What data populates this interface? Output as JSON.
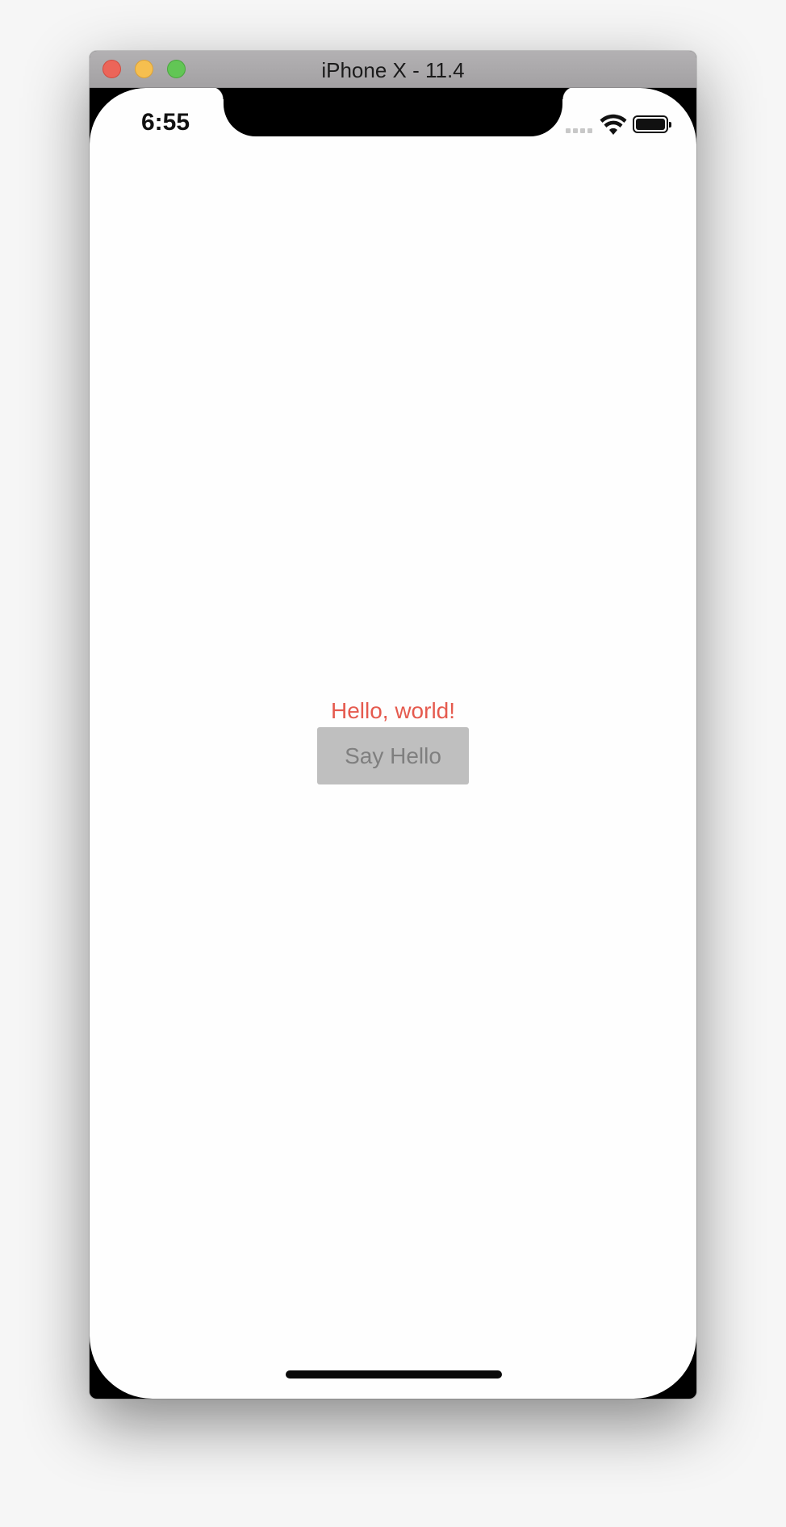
{
  "window": {
    "title": "iPhone X - 11.4"
  },
  "status_bar": {
    "time": "6:55",
    "icons": [
      "cellular-signal-icon",
      "wifi-icon",
      "battery-icon"
    ]
  },
  "app": {
    "label_text": "Hello, world!",
    "label_color": "#e55a4e",
    "button_label": "Say Hello"
  },
  "colors": {
    "button_background": "#bfbfbf",
    "button_text": "#7f7f7f"
  }
}
